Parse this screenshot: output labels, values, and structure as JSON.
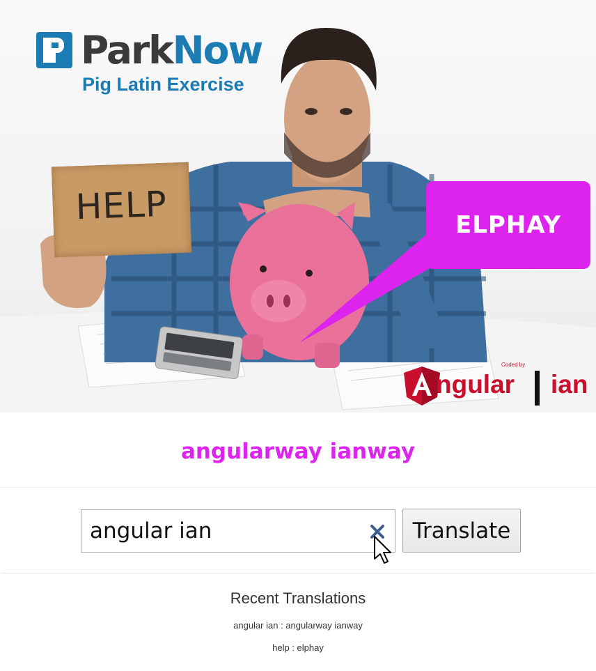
{
  "brand": {
    "name_part1": "Park",
    "name_part2": "Now",
    "subtitle": "Pig Latin Exercise"
  },
  "hero": {
    "sign_text": "HELP",
    "bubble_text": "ELPHAY",
    "credit": {
      "coded_by": "Coded by",
      "word1": "ngular",
      "word2": "ian"
    }
  },
  "result": {
    "text": "angularway ianway",
    "color": "#dd24ee"
  },
  "form": {
    "input_value": "angular ian",
    "clear_icon": "close-icon",
    "translate_label": "Translate"
  },
  "recent": {
    "title": "Recent Translations",
    "items": [
      {
        "text": "angular ian : angularway ianway"
      },
      {
        "text": "help : elphay"
      }
    ]
  },
  "colors": {
    "brand_blue": "#1b7bb3",
    "accent_magenta": "#dd24ee",
    "angular_red": "#c8102e"
  }
}
